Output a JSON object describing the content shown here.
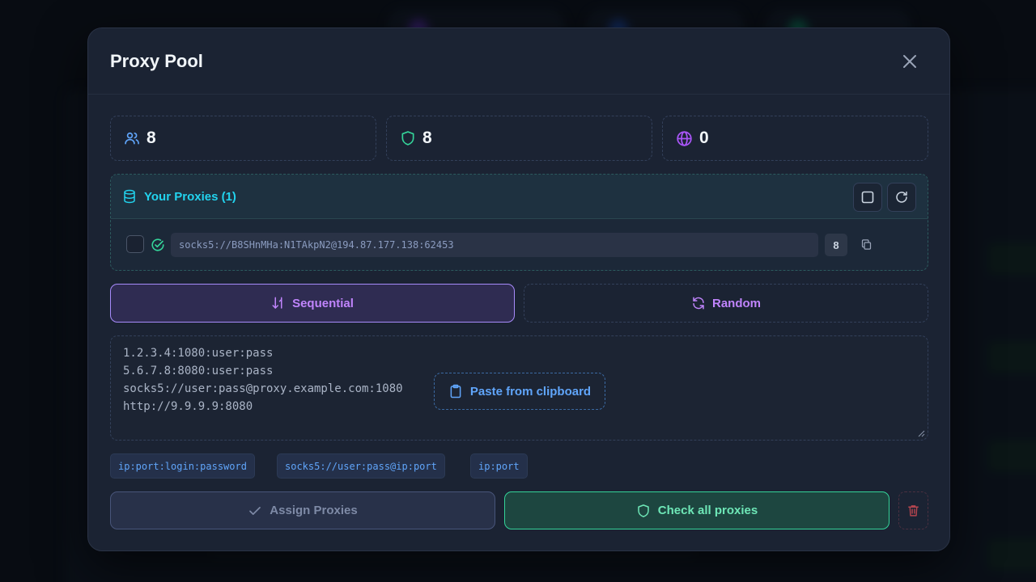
{
  "modal": {
    "title": "Proxy Pool"
  },
  "stats": {
    "users_count": "8",
    "protected_count": "8",
    "global_count": "0"
  },
  "your_proxies": {
    "title": "Your Proxies (1)",
    "items": [
      {
        "value": "socks5://B8SHnMHa:N1TAkpN2@194.87.177.138:62453",
        "count": "8"
      }
    ]
  },
  "modes": {
    "sequential_label": "Sequential",
    "random_label": "Random",
    "selected": "Sequential"
  },
  "input": {
    "lines": [
      "1.2.3.4:1080:user:pass",
      "5.6.7.8:8080:user:pass",
      "socks5://user:pass@proxy.example.com:1080",
      "http://9.9.9.9:8080"
    ],
    "paste_label": "Paste from clipboard"
  },
  "formats": [
    "ip:port:login:password",
    "socks5://user:pass@ip:port",
    "ip:port"
  ],
  "actions": {
    "assign_label": "Assign Proxies",
    "check_label": "Check all proxies"
  },
  "colors": {
    "accent_purple": "#c084fc",
    "accent_cyan": "#22d3ee",
    "accent_green": "#34d399",
    "accent_blue": "#60a5fa",
    "danger": "#ef4444"
  },
  "icons": {
    "close": "close-icon",
    "users": "users-icon",
    "shield": "shield-icon",
    "globe": "globe-icon",
    "database": "database-icon",
    "select_all": "square-icon",
    "refresh": "refresh-icon",
    "status_ok": "check-circle-icon",
    "copy": "copy-icon",
    "sequential": "sort-icon",
    "random": "shuffle-icon",
    "clipboard": "clipboard-icon",
    "assign": "check-icon",
    "check_all": "shield-icon",
    "delete": "trash-icon"
  }
}
